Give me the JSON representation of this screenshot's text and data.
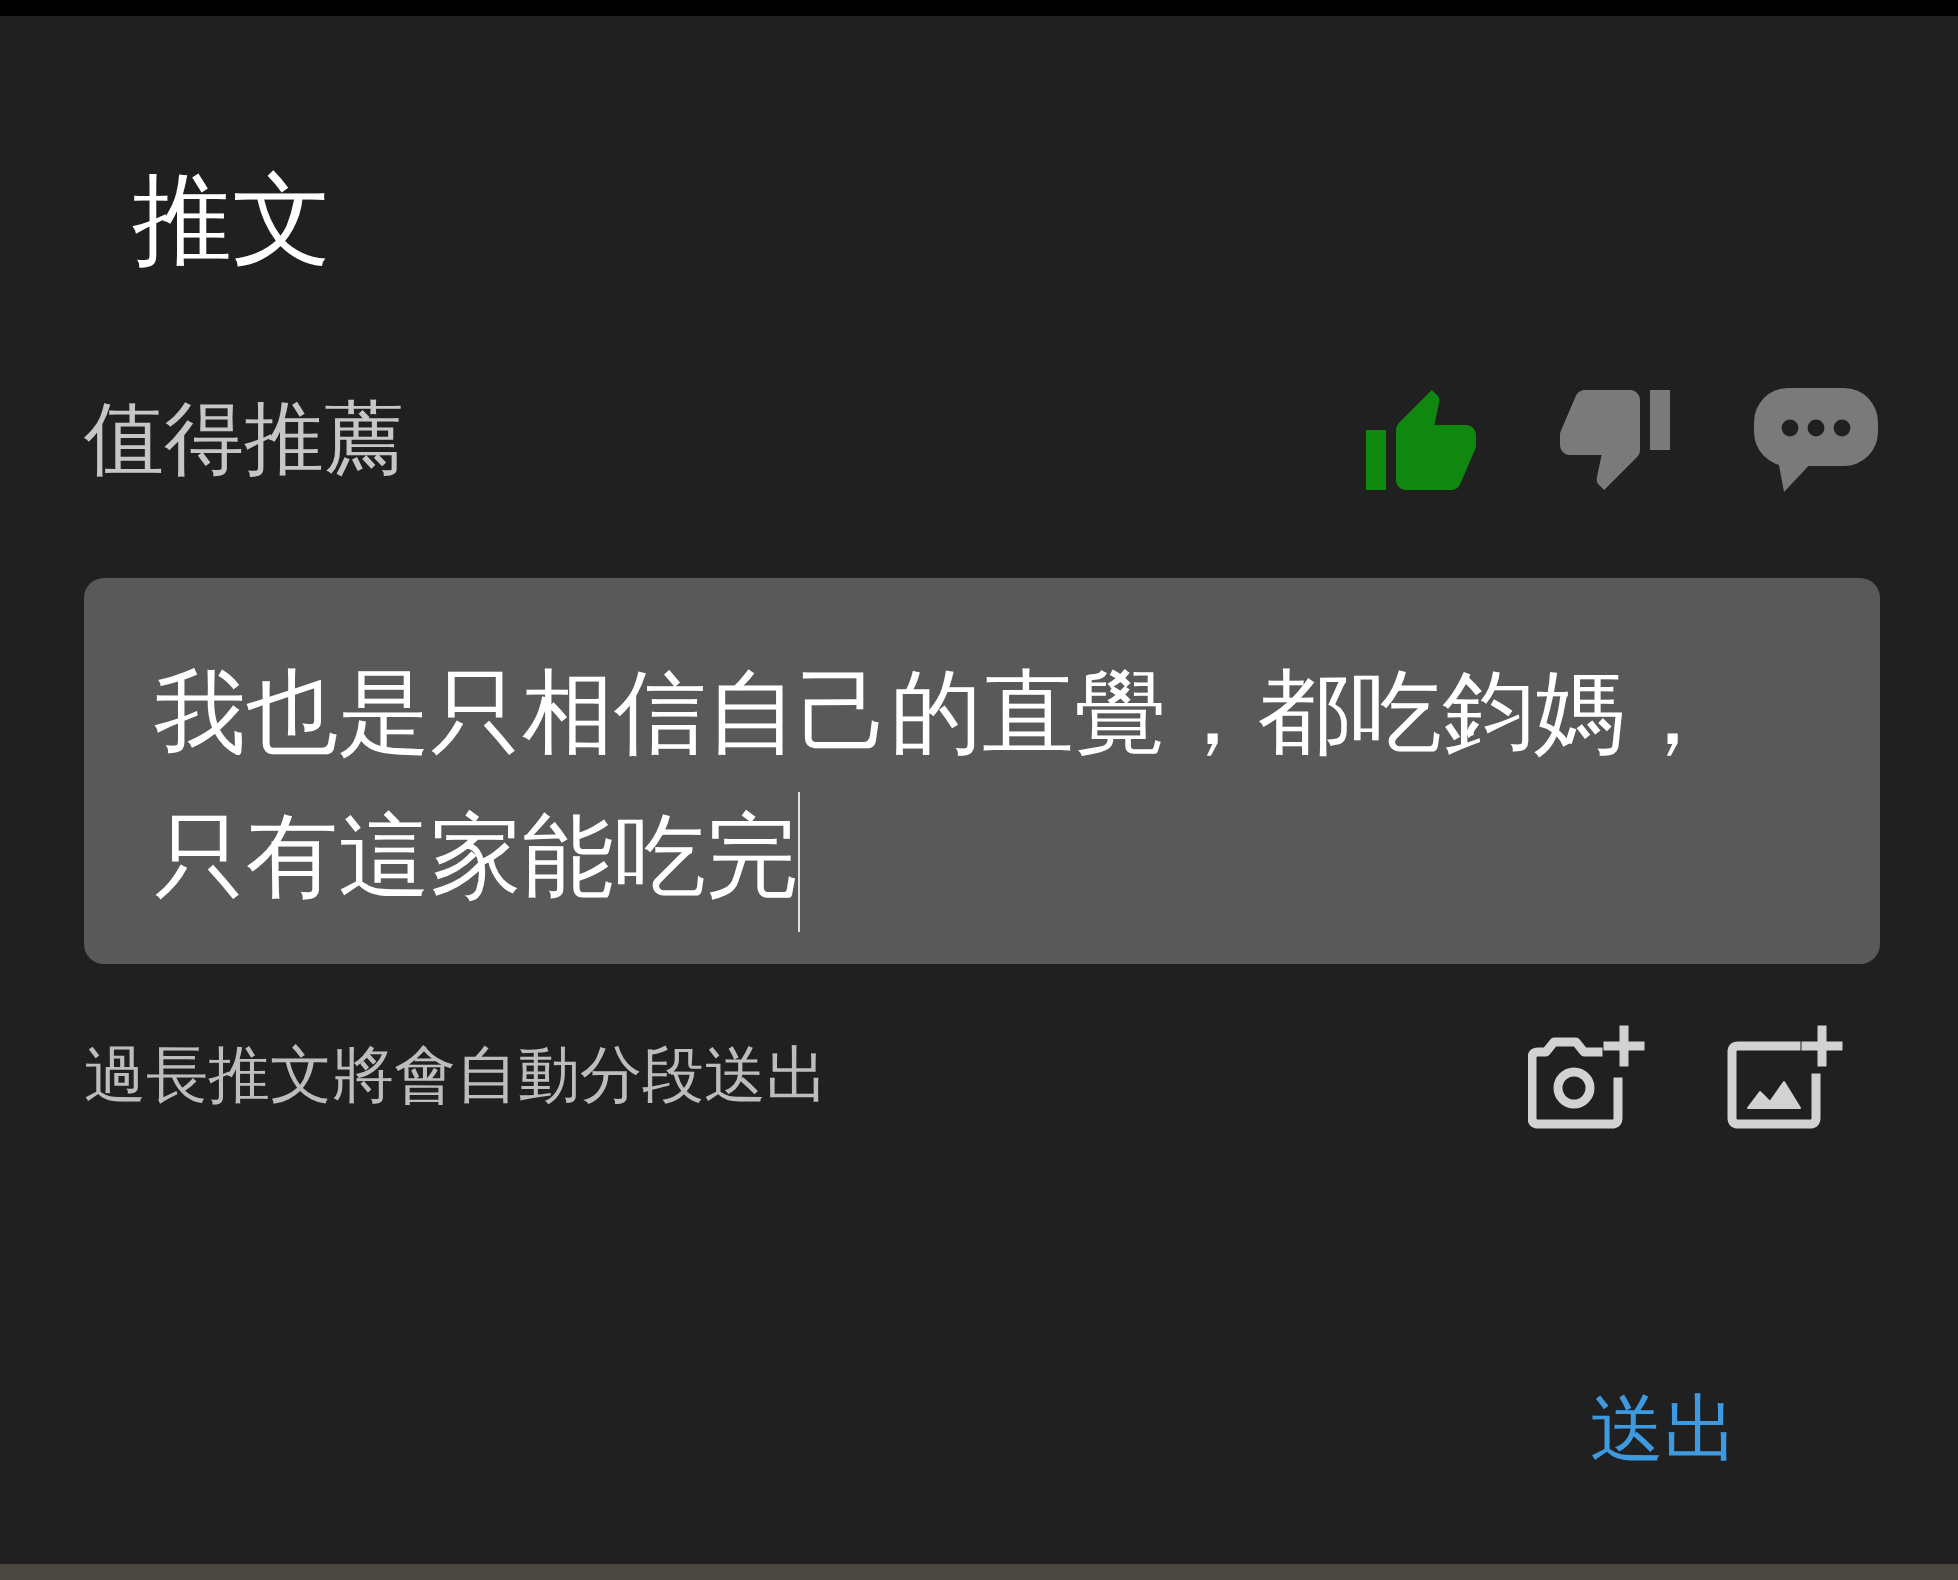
{
  "dialog": {
    "title": "推文"
  },
  "rating": {
    "label": "值得推薦",
    "options": [
      {
        "kind": "like",
        "selected": true
      },
      {
        "kind": "dislike",
        "selected": false
      },
      {
        "kind": "comment",
        "selected": false
      }
    ]
  },
  "comment_field": {
    "value": "我也是只相信自己的直覺，都吃鈞媽，只有這家能吃完",
    "focused": true
  },
  "hint": "過長推文將會自動分段送出",
  "attachments": [
    {
      "kind": "camera"
    },
    {
      "kind": "image"
    }
  ],
  "submit_button": "送出"
}
